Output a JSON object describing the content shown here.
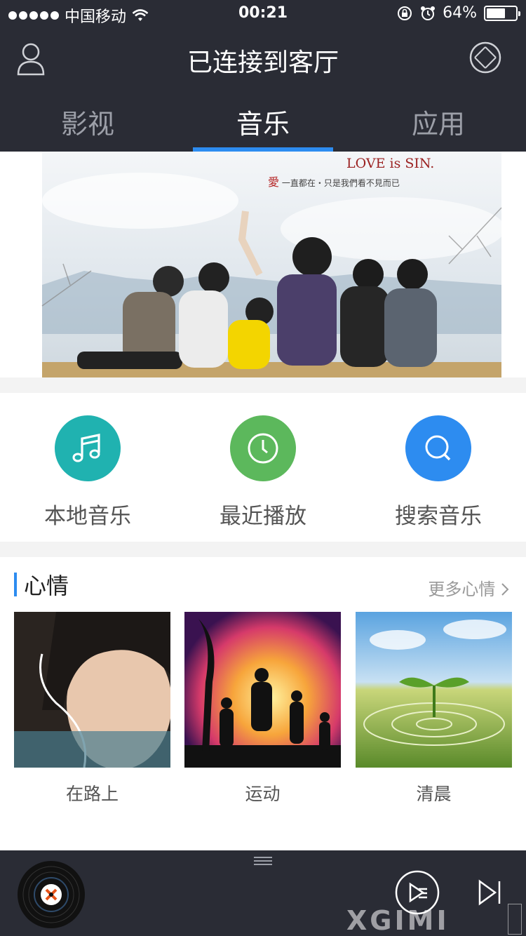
{
  "status_bar": {
    "carrier": "中国移动",
    "time": "00:21",
    "battery_text": "64%",
    "battery_level": 0.64
  },
  "header": {
    "title": "已连接到客厅",
    "icons": {
      "left": "user-icon",
      "right": "remote-control-icon"
    }
  },
  "tabs": [
    {
      "label": "影视",
      "active": false
    },
    {
      "label": "音乐",
      "active": true
    },
    {
      "label": "应用",
      "active": false
    }
  ],
  "banner": {
    "title": "LOVE is SIN.",
    "subtitle_mark": "愛",
    "subtitle": "一直都在・只是我們看不見而已"
  },
  "quick_actions": [
    {
      "label": "本地音乐",
      "icon": "music-note-icon",
      "color": "#20b2b0"
    },
    {
      "label": "最近播放",
      "icon": "clock-icon",
      "color": "#5cb85c"
    },
    {
      "label": "搜索音乐",
      "icon": "search-icon",
      "color": "#2d8cf0"
    }
  ],
  "mood_section": {
    "title": "心情",
    "more_label": "更多心情",
    "items": [
      {
        "label": "在路上"
      },
      {
        "label": "运动"
      },
      {
        "label": "清晨"
      }
    ]
  },
  "player": {
    "icons": [
      "vinyl-disc-icon",
      "play-queue-icon",
      "next-track-icon"
    ],
    "watermark": "XGIMI"
  },
  "colors": {
    "header_bg": "#2a2c35",
    "accent": "#2d8cf0"
  }
}
